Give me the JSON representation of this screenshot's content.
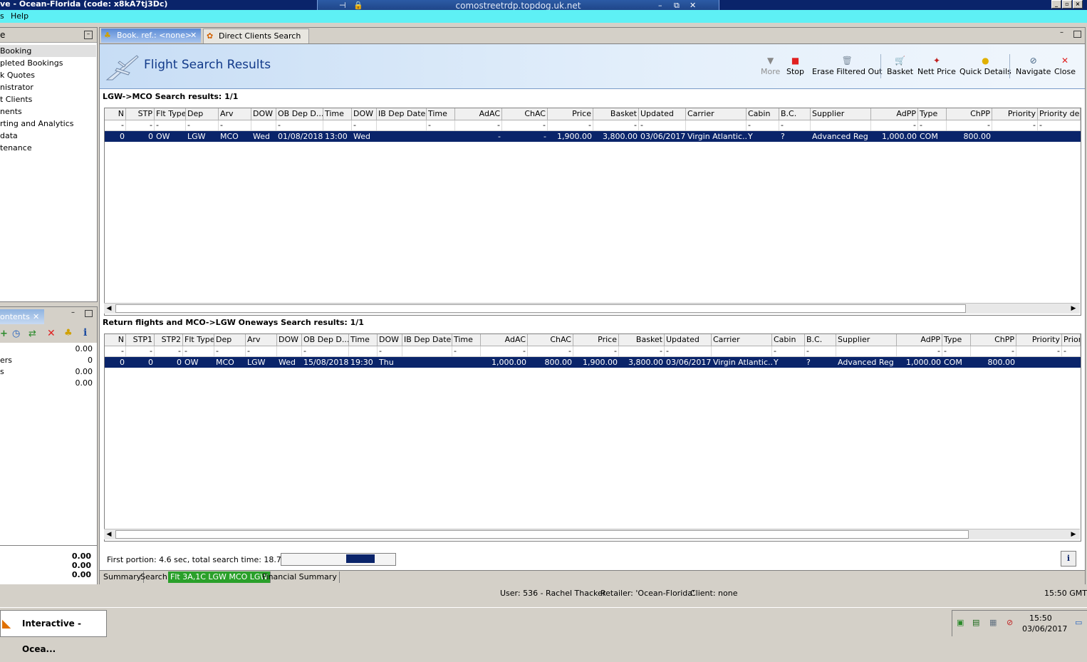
{
  "window": {
    "title": "ve - Ocean-Florida (code: x8kA7tj3Dc)"
  },
  "rdp": {
    "host": "comostreetrdp.topdog.uk.net"
  },
  "menu": {
    "items": [
      "s",
      "Help"
    ]
  },
  "left_panel": {
    "title": "e",
    "items": [
      "Booking",
      "pleted Bookings",
      "k Quotes",
      "nistrator",
      "t Clients",
      "nents",
      "rting and Analytics",
      "data",
      "tenance"
    ]
  },
  "contents_panel": {
    "tab_label": "ontents",
    "rows": [
      {
        "label": "",
        "value": "0.00"
      },
      {
        "label": "ers",
        "value": "0"
      },
      {
        "label": "s",
        "value": "0.00"
      },
      {
        "label": "",
        "value": "0.00"
      }
    ],
    "totals": [
      "0.00",
      "0.00",
      "0.00"
    ]
  },
  "tabs": [
    {
      "label": "Book. ref.: <none>"
    },
    {
      "label": "Direct Clients Search"
    }
  ],
  "header": {
    "title": "Flight Search Results"
  },
  "toolbar": {
    "more": "More",
    "stop": "Stop",
    "erase": "Erase Filtered Out",
    "basket": "Basket",
    "nett_price": "Nett Price",
    "quick_details": "Quick Details",
    "navigate": "Navigate",
    "close": "Close"
  },
  "outbound": {
    "title": "LGW->MCO Search results: 1/1",
    "columns": [
      "N",
      "STP",
      "Flt Type",
      "Dep",
      "Arv",
      "DOW",
      "OB Dep D...",
      "Time",
      "DOW",
      "IB Dep Date",
      "Time",
      "AdAC",
      "ChAC",
      "Price",
      "Basket",
      "Updated",
      "Carrier",
      "Cabin",
      "B.C.",
      "Supplier",
      "AdPP",
      "Type",
      "ChPP",
      "Priority",
      "Priority desc"
    ],
    "filter": [
      "-",
      "-",
      "-",
      "-",
      "-",
      "",
      "-",
      "",
      "-",
      "",
      "-",
      "-",
      "-",
      "-",
      "-",
      "-",
      "",
      "-",
      "-",
      "",
      "-",
      "-",
      "-",
      "-",
      "-"
    ],
    "rows": [
      [
        "0",
        "0",
        "OW",
        "LGW",
        "MCO",
        "Wed",
        "01/08/2018",
        "13:00",
        "Wed",
        "",
        "",
        "-",
        "-",
        "1,900.00",
        "3,800.00",
        "03/06/2017",
        "Virgin Atlantic...",
        "Y",
        "?",
        "Advanced Reg",
        "1,000.00",
        "COM",
        "800.00",
        "",
        ""
      ]
    ]
  },
  "return": {
    "title": "Return flights and MCO->LGW Oneways Search results: 1/1",
    "columns": [
      "N",
      "STP1",
      "STP2",
      "Flt Type",
      "Dep",
      "Arv",
      "DOW",
      "OB Dep D...",
      "Time",
      "DOW",
      "IB Dep Date",
      "Time",
      "AdAC",
      "ChAC",
      "Price",
      "Basket",
      "Updated",
      "Carrier",
      "Cabin",
      "B.C.",
      "Supplier",
      "AdPP",
      "Type",
      "ChPP",
      "Priority",
      "Prior"
    ],
    "filter": [
      "-",
      "-",
      "-",
      "-",
      "-",
      "-",
      "",
      "-",
      "",
      "-",
      "",
      "-",
      "-",
      "-",
      "-",
      "-",
      "-",
      "",
      "-",
      "-",
      "",
      "-",
      "-",
      "-",
      "-",
      "-"
    ],
    "rows": [
      [
        "0",
        "0",
        "0",
        "OW",
        "MCO",
        "LGW",
        "Wed",
        "15/08/2018",
        "19:30",
        "Thu",
        "",
        "",
        "1,000.00",
        "800.00",
        "1,900.00",
        "3,800.00",
        "03/06/2017",
        "Virgin Atlantic...",
        "Y",
        "?",
        "Advanced Reg",
        "1,000.00",
        "COM",
        "800.00",
        "",
        ""
      ]
    ]
  },
  "status": {
    "timing": "First portion: 4.6 sec, total search time: 18.7 sec",
    "progress": 0.25
  },
  "bottom_tabs": [
    "Summary",
    "Search",
    "Flt 3A,1C LGW MCO LGW",
    "Financial Summary"
  ],
  "app_status": {
    "user": "User: 536 - Rachel Thacker",
    "retailer": "Retailer: 'Ocean-Florida'",
    "client": "Client: none",
    "time": "15:50 GMT"
  },
  "taskbar": {
    "app": "Interactive - Ocea...",
    "clock_time": "15:50",
    "clock_date": "03/06/2017"
  },
  "colors": {
    "selection": "#0a246a",
    "accent": "#123a8a",
    "highlight_tab": "#2aa02a",
    "menubar": "#5ef0f5"
  }
}
